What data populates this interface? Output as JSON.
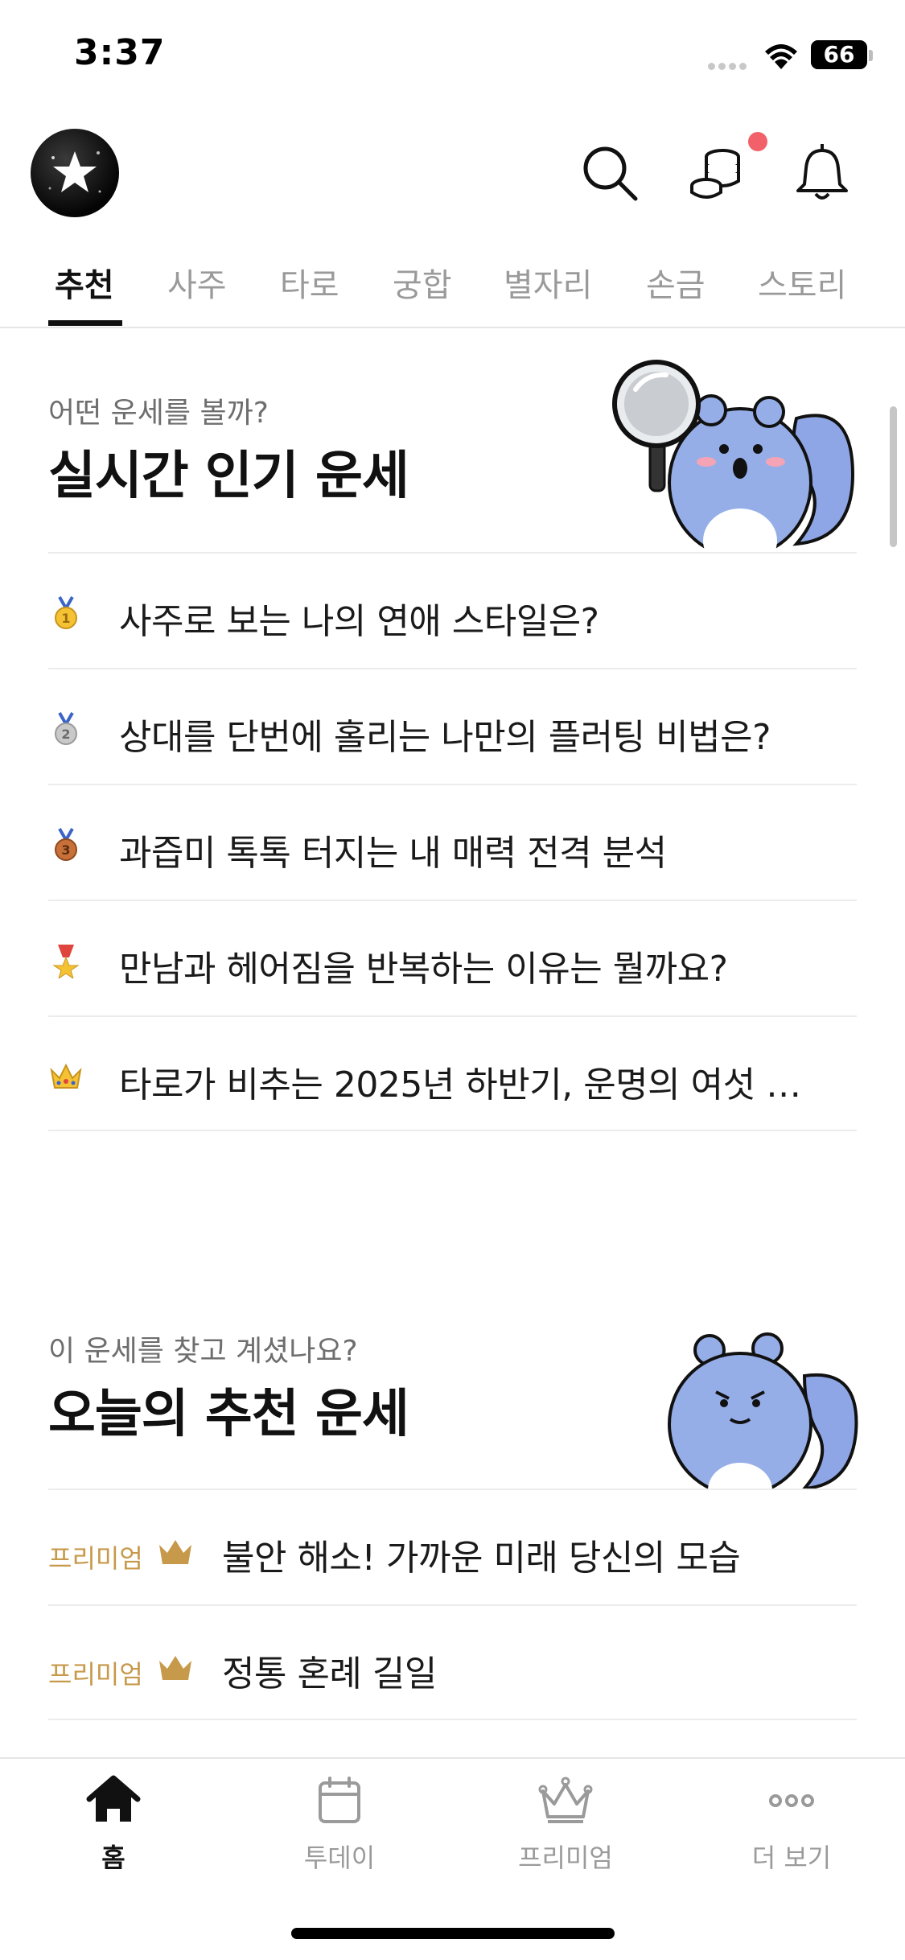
{
  "status_bar": {
    "time": "3:37",
    "battery": "66",
    "battery_level": 0.66
  },
  "header": {
    "icons": [
      "star-logo-icon",
      "search-icon",
      "coins-icon",
      "bell-icon"
    ],
    "notification_dot_color": "#f2616a"
  },
  "tabs": [
    {
      "label": "추천",
      "active": true
    },
    {
      "label": "사주"
    },
    {
      "label": "타로"
    },
    {
      "label": "궁합"
    },
    {
      "label": "별자리"
    },
    {
      "label": "손금"
    },
    {
      "label": "스토리"
    }
  ],
  "popular": {
    "subtitle": "어떤 운세를 볼까?",
    "title": "실시간 인기 운세",
    "items": [
      {
        "icon": "gold-medal-icon",
        "text": "사주로 보는 나의 연애 스타일은?"
      },
      {
        "icon": "silver-medal-icon",
        "text": "상대를 단번에 홀리는 나만의 플러팅 비법은?"
      },
      {
        "icon": "bronze-medal-icon",
        "text": "과즙미 톡톡 터지는 내 매력 전격 분석"
      },
      {
        "icon": "military-medal-icon",
        "text": "만남과 헤어짐을 반복하는 이유는 뭘까요?"
      },
      {
        "icon": "crown-icon",
        "text": "타로가 비추는 2025년 하반기, 운명의 여섯 …"
      }
    ]
  },
  "recommended": {
    "subtitle": "이 운세를 찾고 계셨나요?",
    "title": "오늘의 추천 운세",
    "items": [
      {
        "tag": "프리미엄",
        "text": "불안 해소! 가까운 미래 당신의 모습"
      },
      {
        "tag": "프리미엄",
        "text": "정통 혼례 길일"
      }
    ]
  },
  "bottom_nav": [
    {
      "label": "홈",
      "icon": "home-icon",
      "active": true
    },
    {
      "label": "투데이",
      "icon": "calendar-icon"
    },
    {
      "label": "프리미엄",
      "icon": "crown-icon"
    },
    {
      "label": "더 보기",
      "icon": "more-icon"
    }
  ],
  "colors": {
    "premium": "#c7994a",
    "mascot": "#8ea6e6",
    "active_text": "#111111",
    "inactive_text": "#9a9a9a"
  }
}
